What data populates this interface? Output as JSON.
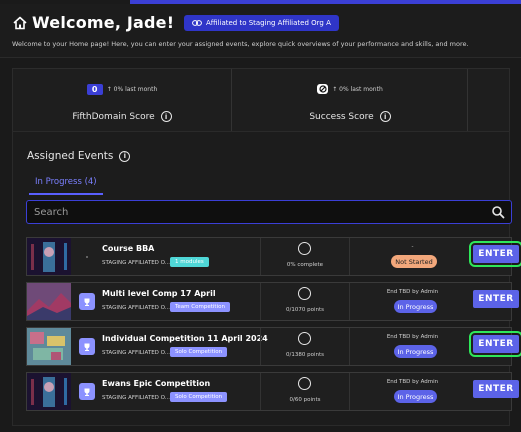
{
  "colors": {
    "accent": "#3b3fd6",
    "enter_bg": "#5c63e8",
    "highlight": "#2ee85a",
    "not_started": "#f2a77b",
    "module_tag": "#4fd7d7",
    "comp_tag": "#8c92ff"
  },
  "header": {
    "title": "Welcome, Jade!",
    "affiliation": "Affiliated to Staging Affiliated Org A",
    "subtitle": "Welcome to your Home page! Here, you can enter your assigned events, explore quick overviews of your performance and skills, and more."
  },
  "scores": [
    {
      "value": "0",
      "delta": "↑ 0% last month",
      "label": "FifthDomain Score",
      "icon": "info-icon"
    },
    {
      "value": "",
      "delta": "↑ 0% last month",
      "label": "Success Score",
      "icon": "info-icon"
    }
  ],
  "events": {
    "title": "Assigned Events",
    "tab": "In Progress (4)",
    "search_placeholder": "Search",
    "rows": [
      {
        "name": "Course BBA",
        "org": "STAGING AFFILIATED O...",
        "tag": "1 modules",
        "progress": "0% complete",
        "end": "-",
        "status": "Not Started",
        "enter": "ENTER",
        "highlight": true
      },
      {
        "name": "Multi level Comp 17 April",
        "org": "STAGING AFFILIATED O...",
        "tag": "Team Competition",
        "progress": "0/1070 points",
        "end": "End TBD by Admin",
        "status": "In Progress",
        "enter": "ENTER",
        "highlight": false
      },
      {
        "name": "Individual Competition 11 April 2024",
        "org": "STAGING AFFILIATED O...",
        "tag": "Solo Competition",
        "progress": "0/1380 points",
        "end": "End TBD by Admin",
        "status": "In Progress",
        "enter": "ENTER",
        "highlight": true
      },
      {
        "name": "Ewans Epic Competition",
        "org": "STAGING AFFILIATED O...",
        "tag": "Solo Competition",
        "progress": "0/60 points",
        "end": "End TBD by Admin",
        "status": "In Progress",
        "enter": "ENTER",
        "highlight": false
      }
    ]
  }
}
